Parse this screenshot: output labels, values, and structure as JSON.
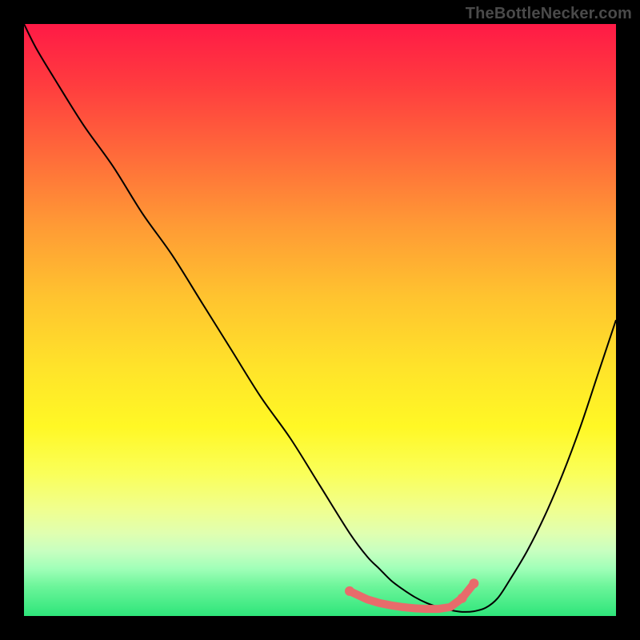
{
  "attribution": "TheBottleNecker.com",
  "colors": {
    "gradient_top": "#ff1a46",
    "gradient_bottom": "#2ee57a",
    "curve": "#000000",
    "markers": "#e86b6b",
    "frame": "#000000"
  },
  "chart_data": {
    "type": "line",
    "title": "",
    "xlabel": "",
    "ylabel": "",
    "xlim": [
      0,
      100
    ],
    "ylim": [
      0,
      100
    ],
    "x": [
      0,
      2,
      5,
      10,
      15,
      20,
      25,
      30,
      35,
      40,
      45,
      50,
      55,
      58,
      60,
      62,
      64,
      66,
      68,
      70,
      72,
      74,
      76,
      78,
      80,
      82,
      85,
      88,
      91,
      94,
      97,
      100
    ],
    "y": [
      100,
      96,
      91,
      83,
      76,
      68,
      61,
      53,
      45,
      37,
      30,
      22,
      14,
      10,
      8,
      6,
      4.5,
      3.2,
      2.2,
      1.5,
      1,
      0.7,
      0.8,
      1.4,
      3,
      6,
      11,
      17,
      24,
      32,
      41,
      50
    ],
    "markers": {
      "x": [
        55,
        58,
        60,
        62,
        64,
        66,
        68,
        70,
        72,
        74,
        76
      ],
      "y": [
        4.2,
        2.8,
        2.2,
        1.8,
        1.5,
        1.3,
        1.2,
        1.2,
        1.5,
        3.0,
        5.5
      ]
    }
  }
}
